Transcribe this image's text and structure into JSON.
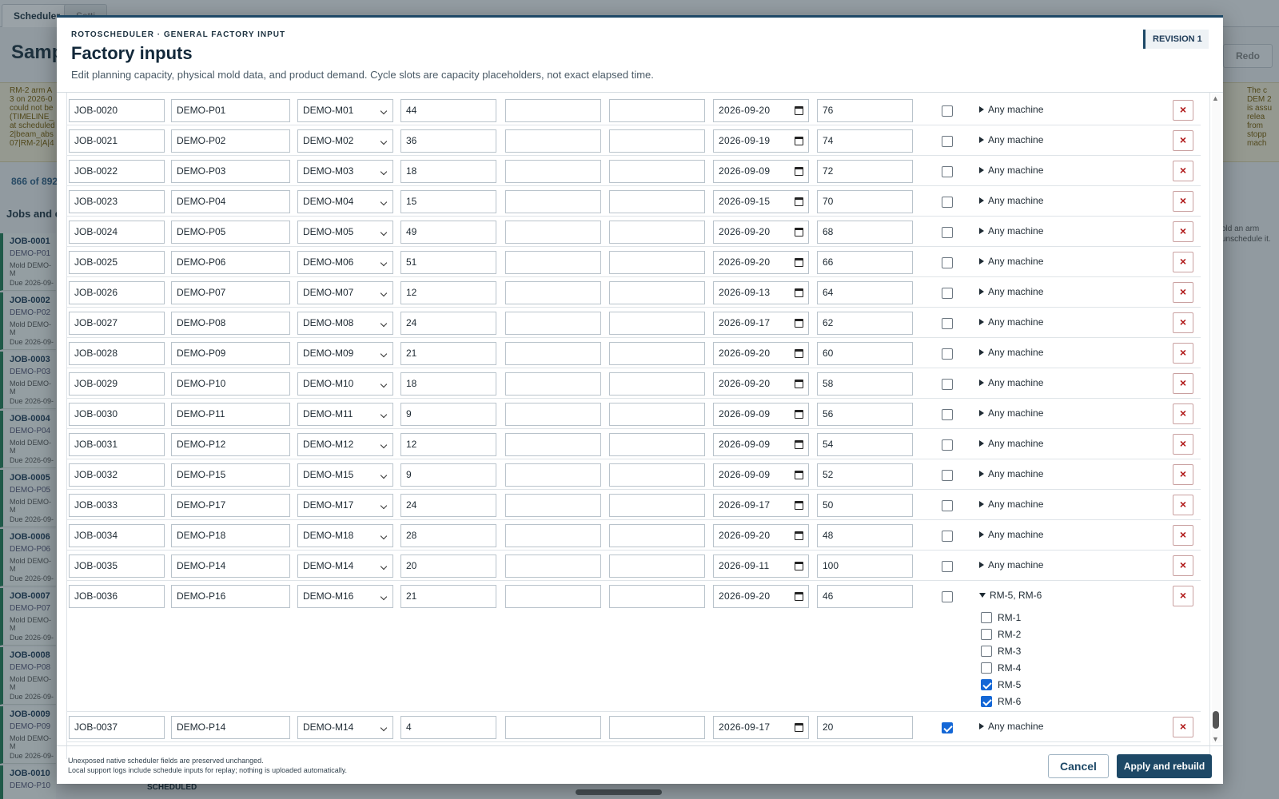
{
  "background": {
    "tabs": [
      "Scheduler",
      "Setti"
    ],
    "title": "Sampl",
    "redo_label": "Redo",
    "note_left": "RM-2 arm A 3 on 2026-0 could not be (TIMELINE_ at scheduled 2|beam_abs 07|RM-2|A|4",
    "note_right": "The c DEM 2 is assu relea from stopp mach",
    "count_text": "866 of 892",
    "jobs_header": "Jobs and e",
    "right_text": "old an arm unschedule it.",
    "scheduled_label": "SCHEDULED",
    "jobs": [
      {
        "id": "JOB-0001",
        "product": "DEMO-P01",
        "mold": "Mold DEMO-M",
        "due": "Due 2026-09-"
      },
      {
        "id": "JOB-0002",
        "product": "DEMO-P02",
        "mold": "Mold DEMO-M",
        "due": "Due 2026-09-"
      },
      {
        "id": "JOB-0003",
        "product": "DEMO-P03",
        "mold": "Mold DEMO-M",
        "due": "Due 2026-09-"
      },
      {
        "id": "JOB-0004",
        "product": "DEMO-P04",
        "mold": "Mold DEMO-M",
        "due": "Due 2026-09-"
      },
      {
        "id": "JOB-0005",
        "product": "DEMO-P05",
        "mold": "Mold DEMO-M",
        "due": "Due 2026-09-"
      },
      {
        "id": "JOB-0006",
        "product": "DEMO-P06",
        "mold": "Mold DEMO-M",
        "due": "Due 2026-09-"
      },
      {
        "id": "JOB-0007",
        "product": "DEMO-P07",
        "mold": "Mold DEMO-M",
        "due": "Due 2026-09-"
      },
      {
        "id": "JOB-0008",
        "product": "DEMO-P08",
        "mold": "Mold DEMO-M",
        "due": "Due 2026-09-"
      },
      {
        "id": "JOB-0009",
        "product": "DEMO-P09",
        "mold": "Mold DEMO-M",
        "due": "Due 2026-09-"
      },
      {
        "id": "JOB-0010",
        "product": "DEMO-P10",
        "mold": "",
        "due": ""
      }
    ]
  },
  "modal": {
    "kicker": "ROTOSCHEDULER · GENERAL FACTORY INPUT",
    "title": "Factory inputs",
    "description": "Edit planning capacity, physical mold data, and product demand. Cycle slots are capacity placeholders, not exact elapsed time.",
    "revision": "REVISION 1",
    "footer_note_1": "Unexposed native scheduler fields are preserved unchanged.",
    "footer_note_2": "Local support logs include schedule inputs for replay; nothing is uploaded automatically.",
    "cancel_label": "Cancel",
    "apply_label": "Apply and rebuild",
    "delete_glyph": "×",
    "rows": [
      {
        "job": "JOB-0020",
        "product": "DEMO-P01",
        "mold": "DEMO-M01",
        "qty": "44",
        "extra1": "",
        "extra2": "",
        "due": "2026-09-20",
        "priority": "76",
        "locked": false,
        "machines": "Any machine"
      },
      {
        "job": "JOB-0021",
        "product": "DEMO-P02",
        "mold": "DEMO-M02",
        "qty": "36",
        "extra1": "",
        "extra2": "",
        "due": "2026-09-19",
        "priority": "74",
        "locked": false,
        "machines": "Any machine"
      },
      {
        "job": "JOB-0022",
        "product": "DEMO-P03",
        "mold": "DEMO-M03",
        "qty": "18",
        "extra1": "",
        "extra2": "",
        "due": "2026-09-09",
        "priority": "72",
        "locked": false,
        "machines": "Any machine"
      },
      {
        "job": "JOB-0023",
        "product": "DEMO-P04",
        "mold": "DEMO-M04",
        "qty": "15",
        "extra1": "",
        "extra2": "",
        "due": "2026-09-15",
        "priority": "70",
        "locked": false,
        "machines": "Any machine"
      },
      {
        "job": "JOB-0024",
        "product": "DEMO-P05",
        "mold": "DEMO-M05",
        "qty": "49",
        "extra1": "",
        "extra2": "",
        "due": "2026-09-20",
        "priority": "68",
        "locked": false,
        "machines": "Any machine"
      },
      {
        "job": "JOB-0025",
        "product": "DEMO-P06",
        "mold": "DEMO-M06",
        "qty": "51",
        "extra1": "",
        "extra2": "",
        "due": "2026-09-20",
        "priority": "66",
        "locked": false,
        "machines": "Any machine"
      },
      {
        "job": "JOB-0026",
        "product": "DEMO-P07",
        "mold": "DEMO-M07",
        "qty": "12",
        "extra1": "",
        "extra2": "",
        "due": "2026-09-13",
        "priority": "64",
        "locked": false,
        "machines": "Any machine"
      },
      {
        "job": "JOB-0027",
        "product": "DEMO-P08",
        "mold": "DEMO-M08",
        "qty": "24",
        "extra1": "",
        "extra2": "",
        "due": "2026-09-17",
        "priority": "62",
        "locked": false,
        "machines": "Any machine"
      },
      {
        "job": "JOB-0028",
        "product": "DEMO-P09",
        "mold": "DEMO-M09",
        "qty": "21",
        "extra1": "",
        "extra2": "",
        "due": "2026-09-20",
        "priority": "60",
        "locked": false,
        "machines": "Any machine"
      },
      {
        "job": "JOB-0029",
        "product": "DEMO-P10",
        "mold": "DEMO-M10",
        "qty": "18",
        "extra1": "",
        "extra2": "",
        "due": "2026-09-20",
        "priority": "58",
        "locked": false,
        "machines": "Any machine"
      },
      {
        "job": "JOB-0030",
        "product": "DEMO-P11",
        "mold": "DEMO-M11",
        "qty": "9",
        "extra1": "",
        "extra2": "",
        "due": "2026-09-09",
        "priority": "56",
        "locked": false,
        "machines": "Any machine"
      },
      {
        "job": "JOB-0031",
        "product": "DEMO-P12",
        "mold": "DEMO-M12",
        "qty": "12",
        "extra1": "",
        "extra2": "",
        "due": "2026-09-09",
        "priority": "54",
        "locked": false,
        "machines": "Any machine"
      },
      {
        "job": "JOB-0032",
        "product": "DEMO-P15",
        "mold": "DEMO-M15",
        "qty": "9",
        "extra1": "",
        "extra2": "",
        "due": "2026-09-09",
        "priority": "52",
        "locked": false,
        "machines": "Any machine"
      },
      {
        "job": "JOB-0033",
        "product": "DEMO-P17",
        "mold": "DEMO-M17",
        "qty": "24",
        "extra1": "",
        "extra2": "",
        "due": "2026-09-17",
        "priority": "50",
        "locked": false,
        "machines": "Any machine"
      },
      {
        "job": "JOB-0034",
        "product": "DEMO-P18",
        "mold": "DEMO-M18",
        "qty": "28",
        "extra1": "",
        "extra2": "",
        "due": "2026-09-20",
        "priority": "48",
        "locked": false,
        "machines": "Any machine"
      },
      {
        "job": "JOB-0035",
        "product": "DEMO-P14",
        "mold": "DEMO-M14",
        "qty": "20",
        "extra1": "",
        "extra2": "",
        "due": "2026-09-11",
        "priority": "100",
        "locked": false,
        "machines": "Any machine"
      },
      {
        "job": "JOB-0036",
        "product": "DEMO-P16",
        "mold": "DEMO-M16",
        "qty": "21",
        "extra1": "",
        "extra2": "",
        "due": "2026-09-20",
        "priority": "46",
        "locked": false,
        "machines": "RM-5, RM-6",
        "expanded": true,
        "machine_options": [
          {
            "label": "RM-1",
            "checked": false
          },
          {
            "label": "RM-2",
            "checked": false
          },
          {
            "label": "RM-3",
            "checked": false
          },
          {
            "label": "RM-4",
            "checked": false
          },
          {
            "label": "RM-5",
            "checked": true
          },
          {
            "label": "RM-6",
            "checked": true
          }
        ]
      },
      {
        "job": "JOB-0037",
        "product": "DEMO-P14",
        "mold": "DEMO-M14",
        "qty": "4",
        "extra1": "",
        "extra2": "",
        "due": "2026-09-17",
        "priority": "20",
        "locked": true,
        "machines": "Any machine"
      }
    ]
  }
}
